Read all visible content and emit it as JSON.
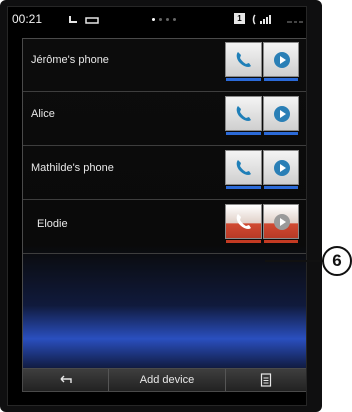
{
  "status": {
    "time": "00:21",
    "page_dots": [
      true,
      false,
      false,
      false
    ],
    "sim_label": "1"
  },
  "devices": [
    {
      "name": "Jérôme's phone",
      "active": false
    },
    {
      "name": "Alice",
      "active": false
    },
    {
      "name": "Mathilde's phone",
      "active": false
    },
    {
      "name": "Elodie",
      "active": true
    }
  ],
  "bottom_bar": {
    "back_icon": "back-arrow-icon",
    "add_device_label": "Add device",
    "menu_icon": "menu-list-icon"
  },
  "callout": {
    "number": "6"
  },
  "colors": {
    "accent_blue": "#2b6ad8",
    "active_red": "#c43a22",
    "background": "#000000"
  }
}
